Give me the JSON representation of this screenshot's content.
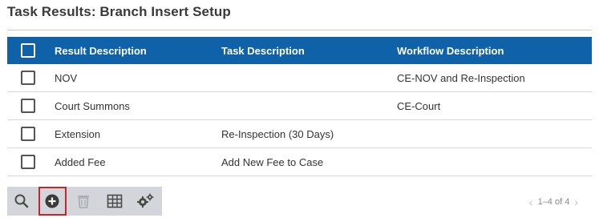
{
  "page": {
    "title": "Task Results: Branch Insert Setup"
  },
  "table": {
    "columns": [
      "Result Description",
      "Task Description",
      "Workflow Description"
    ],
    "rows": [
      {
        "result": "NOV",
        "task": "",
        "workflow": "CE-NOV and Re-Inspection"
      },
      {
        "result": "Court Summons",
        "task": "",
        "workflow": "CE-Court"
      },
      {
        "result": "Extension",
        "task": "Re-Inspection (30 Days)",
        "workflow": ""
      },
      {
        "result": "Added Fee",
        "task": "Add New Fee to Case",
        "workflow": ""
      }
    ]
  },
  "toolbar": {
    "buttons": [
      {
        "icon": "search-icon"
      },
      {
        "icon": "add-circle-icon",
        "selected": true
      },
      {
        "icon": "trash-icon",
        "disabled": true
      },
      {
        "icon": "grid-icon"
      },
      {
        "icon": "gears-icon"
      }
    ]
  },
  "pager": {
    "range_text": "1–4 of 4"
  },
  "colors": {
    "header_bg": "#0f62a8",
    "toolbar_bg": "#d3d5db",
    "selected_border": "#c0282d"
  }
}
